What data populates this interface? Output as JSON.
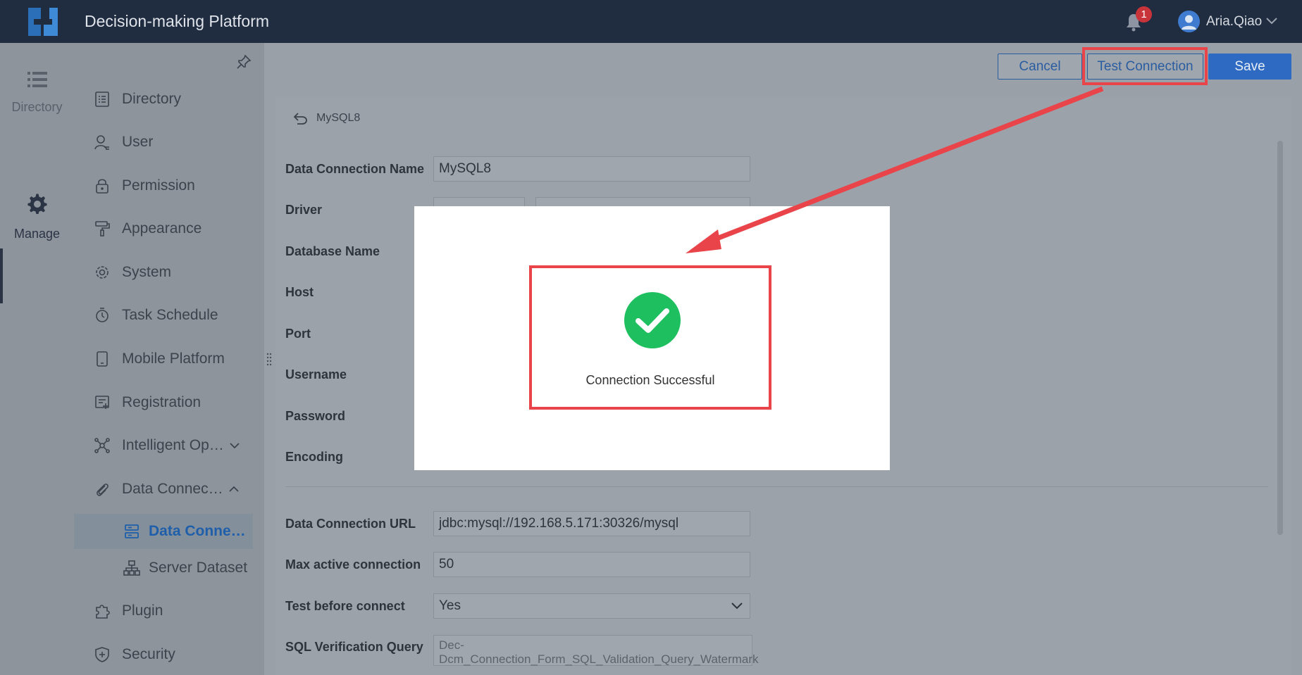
{
  "header": {
    "app_title": "Decision-making Platform",
    "notification_count": "1",
    "user_name": "Aria.Qiao"
  },
  "rail": {
    "directory_label": "Directory",
    "manage_label": "Manage"
  },
  "menu": {
    "items": [
      {
        "label": "Directory",
        "icon": "list-icon"
      },
      {
        "label": "User",
        "icon": "user-icon"
      },
      {
        "label": "Permission",
        "icon": "lock-icon"
      },
      {
        "label": "Appearance",
        "icon": "paint-roller-icon"
      },
      {
        "label": "System",
        "icon": "gear-icon"
      },
      {
        "label": "Task Schedule",
        "icon": "timer-icon"
      },
      {
        "label": "Mobile Platform",
        "icon": "mobile-icon"
      },
      {
        "label": "Registration",
        "icon": "registration-icon"
      },
      {
        "label": "Intelligent Op…",
        "icon": "network-icon"
      },
      {
        "label": "Data Connec…",
        "icon": "paperclip-icon"
      },
      {
        "label": "Plugin",
        "icon": "puzzle-icon"
      },
      {
        "label": "Security",
        "icon": "shield-icon"
      }
    ],
    "sub_items": [
      {
        "label": "Data Conne…",
        "icon": "database-icon"
      },
      {
        "label": "Server Dataset",
        "icon": "hierarchy-icon"
      }
    ]
  },
  "toolbar": {
    "cancel_label": "Cancel",
    "test_label": "Test Connection",
    "save_label": "Save"
  },
  "breadcrumb": {
    "label": "MySQL8"
  },
  "form": {
    "connection_name_label": "Data Connection Name",
    "connection_name_value": "MySQL8",
    "driver_label": "Driver",
    "database_name_label": "Database Name",
    "host_label": "Host",
    "port_label": "Port",
    "username_label": "Username",
    "password_label": "Password",
    "encoding_label": "Encoding",
    "url_label": "Data Connection URL",
    "url_value": "jdbc:mysql://192.168.5.171:30326/mysql",
    "max_active_label": "Max active connection",
    "max_active_value": "50",
    "test_before_label": "Test before connect",
    "test_before_value": "Yes",
    "sql_query_label": "SQL Verification Query",
    "sql_query_placeholder": "Dec-Dcm_Connection_Form_SQL_Validation_Query_Watermark"
  },
  "dialog": {
    "message": "Connection Successful"
  },
  "colors": {
    "success_green": "#1dbf5e",
    "highlight_red": "#e8444a",
    "primary_blue": "#2e6ac2"
  }
}
